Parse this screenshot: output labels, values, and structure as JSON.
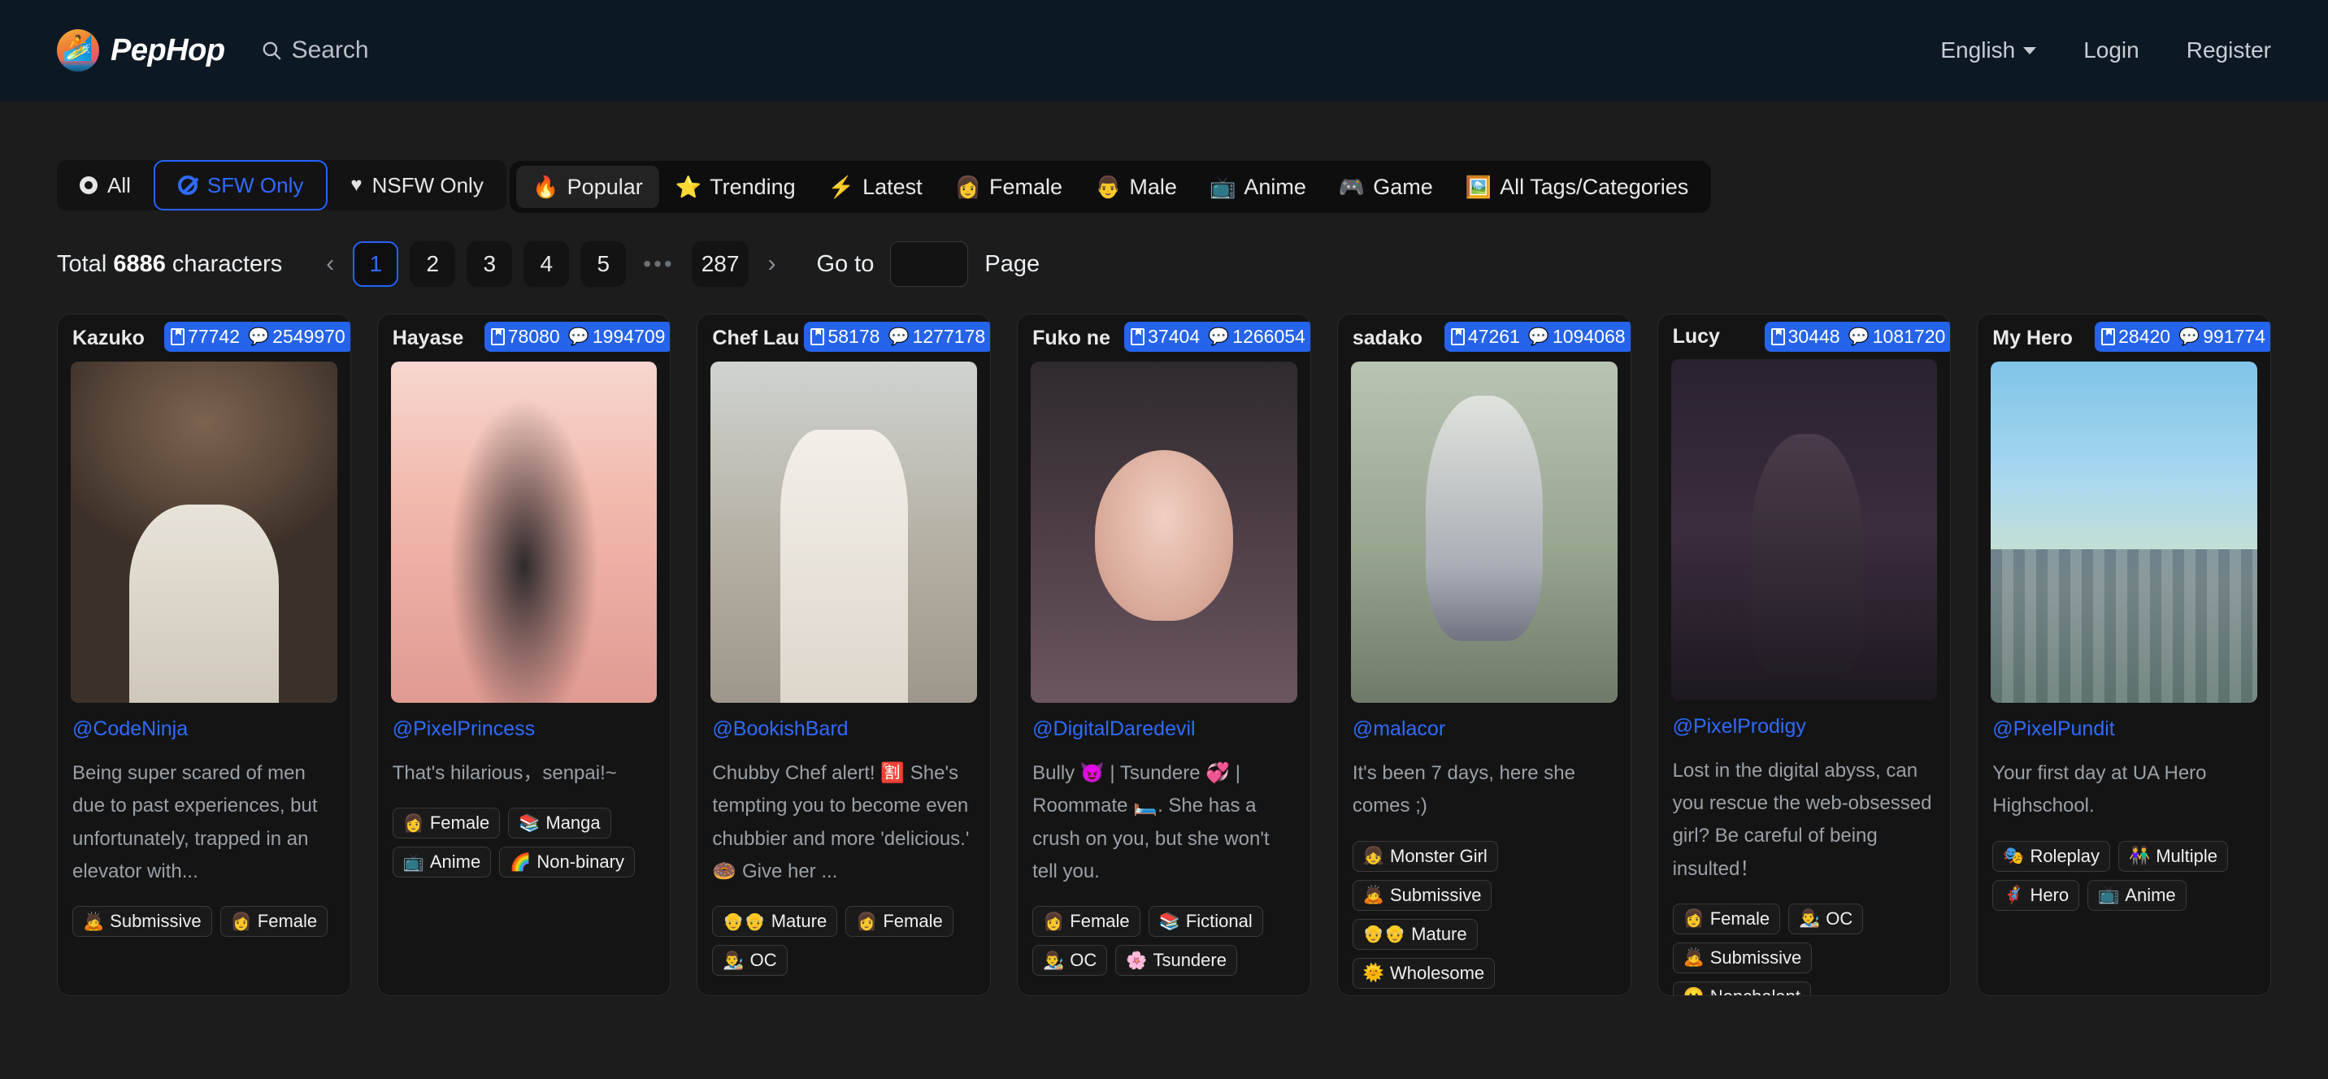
{
  "header": {
    "brand": "PepHop",
    "logo_icon": "surfer-logo-icon",
    "search_label": "Search",
    "search_icon": "search-icon",
    "language": "English",
    "login": "Login",
    "register": "Register",
    "accent": "#2563eb",
    "bar_bg": "#0d1825"
  },
  "content_filter": {
    "options": [
      {
        "label": "All",
        "icon": "eye-icon",
        "active": false
      },
      {
        "label": "SFW Only",
        "icon": "eye-slash-icon",
        "active": true
      },
      {
        "label": "NSFW Only",
        "icon": "heart-icon",
        "active": false
      }
    ]
  },
  "tag_filter": {
    "items": [
      {
        "emoji": "🔥",
        "label": "Popular",
        "active": true
      },
      {
        "emoji": "⭐",
        "label": "Trending",
        "active": false
      },
      {
        "emoji": "⚡",
        "label": "Latest",
        "active": false
      },
      {
        "emoji": "👩",
        "label": "Female",
        "active": false
      },
      {
        "emoji": "👨",
        "label": "Male",
        "active": false
      },
      {
        "emoji": "📺",
        "label": "Anime",
        "active": false
      },
      {
        "emoji": "🎮",
        "label": "Game",
        "active": false
      },
      {
        "emoji": "🖼️",
        "label": "All Tags/Categories",
        "active": false
      }
    ]
  },
  "pagination": {
    "total_prefix": "Total",
    "total_count": "6886",
    "total_suffix": "characters",
    "prev_icon": "chevron-left-icon",
    "next_icon": "chevron-right-icon",
    "pages": [
      "1",
      "2",
      "3",
      "4",
      "5"
    ],
    "ellipsis": "•••",
    "last_page": "287",
    "current_page": "1",
    "goto_label": "Go to",
    "goto_value": "",
    "page_label": "Page"
  },
  "cards": [
    {
      "name": "Kazuko",
      "messages": "77742",
      "chats": "2549970",
      "author": "@CodeNinja",
      "description": "Being super scared of men due to past experiences, but unfortunately, trapped in an elevator with...",
      "art": "art-kazuko",
      "tags": [
        {
          "emoji": "🙇",
          "label": "Submissive"
        },
        {
          "emoji": "👩",
          "label": "Female"
        }
      ]
    },
    {
      "name": "Hayase",
      "messages": "78080",
      "chats": "1994709",
      "author": "@PixelPrincess",
      "description": "That's hilarious，senpai!~",
      "art": "art-hayase",
      "tags": [
        {
          "emoji": "👩",
          "label": "Female"
        },
        {
          "emoji": "📚",
          "label": "Manga"
        },
        {
          "emoji": "📺",
          "label": "Anime"
        },
        {
          "emoji": "🌈",
          "label": "Non-binary"
        }
      ]
    },
    {
      "name": "Chef Lau",
      "messages": "58178",
      "chats": "1277178",
      "author": "@BookishBard",
      "description": "Chubby Chef alert! 🈹 She's tempting you to become even chubbier and more 'delicious.' 🍩 Give her ...",
      "art": "art-chef",
      "tags": [
        {
          "emoji": "👴👴",
          "label": "Mature"
        },
        {
          "emoji": "👩",
          "label": "Female"
        },
        {
          "emoji": "👨‍🎨",
          "label": "OC"
        }
      ]
    },
    {
      "name": "Fuko ne",
      "messages": "37404",
      "chats": "1266054",
      "author": "@DigitalDaredevil",
      "description": "Bully 😈 | Tsundere 💞 | Roommate 🛏️. She has a crush on you, but she won't tell you.",
      "art": "art-fuko",
      "tags": [
        {
          "emoji": "👩",
          "label": "Female"
        },
        {
          "emoji": "📚",
          "label": "Fictional"
        },
        {
          "emoji": "👨‍🎨",
          "label": "OC"
        },
        {
          "emoji": "🌸",
          "label": "Tsundere"
        }
      ]
    },
    {
      "name": "sadako",
      "messages": "47261",
      "chats": "1094068",
      "author": "@malacor",
      "description": "It's been 7 days, here she comes ;)",
      "art": "art-sadako",
      "tags": [
        {
          "emoji": "👧",
          "label": "Monster Girl"
        },
        {
          "emoji": "🙇",
          "label": "Submissive"
        },
        {
          "emoji": "👴👴",
          "label": "Mature"
        },
        {
          "emoji": "🌞",
          "label": "Wholesome"
        }
      ]
    },
    {
      "name": "Lucy",
      "messages": "30448",
      "chats": "1081720",
      "author": "@PixelProdigy",
      "description": "Lost in the digital abyss, can you rescue the web-obsessed girl? Be careful of being insulted！",
      "art": "art-lucy",
      "tags": [
        {
          "emoji": "👩",
          "label": "Female"
        },
        {
          "emoji": "👨‍🎨",
          "label": "OC"
        },
        {
          "emoji": "🙇",
          "label": "Submissive"
        },
        {
          "emoji": "😐",
          "label": "Nonchalant"
        }
      ]
    },
    {
      "name": "My Hero",
      "messages": "28420",
      "chats": "991774",
      "author": "@PixelPundit",
      "description": "Your first day at UA Hero Highschool.",
      "art": "art-hero",
      "tags": [
        {
          "emoji": "🎭",
          "label": "Roleplay"
        },
        {
          "emoji": "👫",
          "label": "Multiple"
        },
        {
          "emoji": "🦸",
          "label": "Hero"
        },
        {
          "emoji": "📺",
          "label": "Anime"
        }
      ]
    }
  ]
}
